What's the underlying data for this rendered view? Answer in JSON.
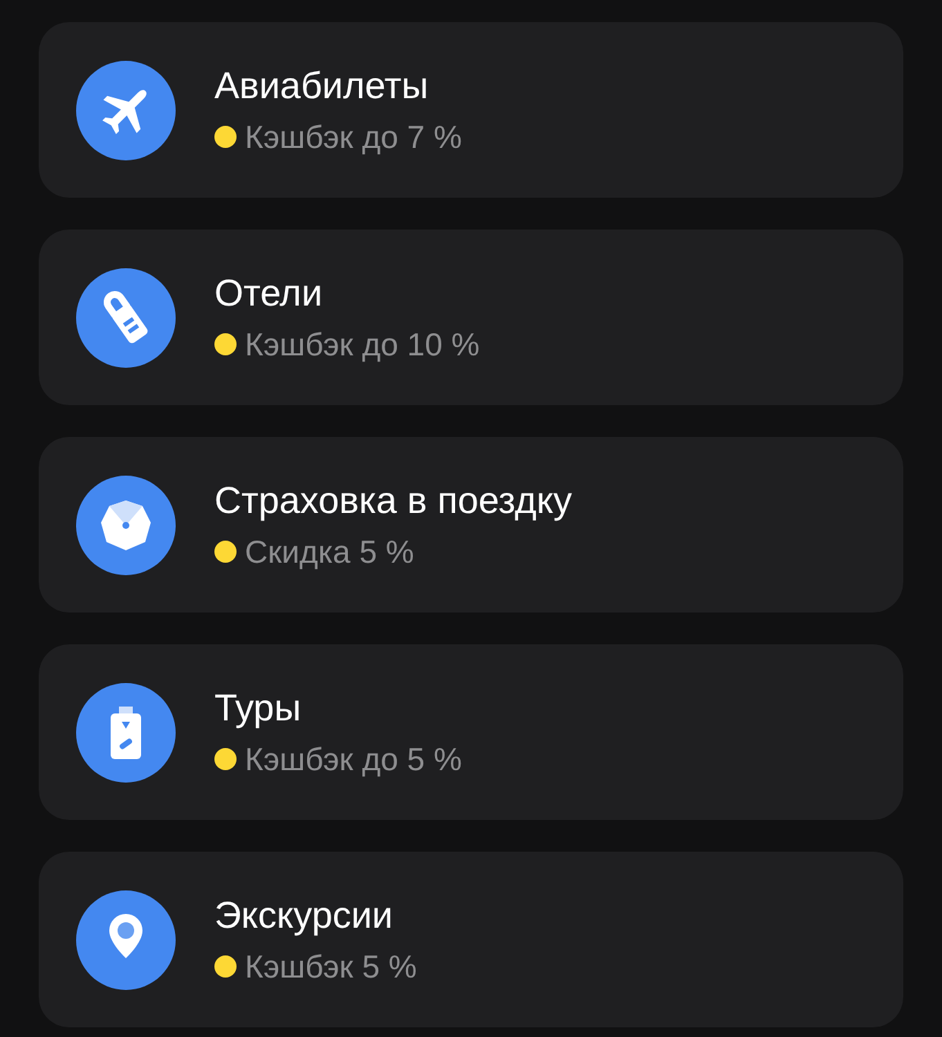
{
  "items": [
    {
      "title": "Авиабилеты",
      "subtitle": "Кэшбэк до 7 %"
    },
    {
      "title": "Отели",
      "subtitle": "Кэшбэк до 10 %"
    },
    {
      "title": "Страховка в поездку",
      "subtitle": "Скидка 5 %"
    },
    {
      "title": "Туры",
      "subtitle": "Кэшбэк до 5 %"
    },
    {
      "title": "Экскурсии",
      "subtitle": "Кэшбэк 5 %"
    }
  ]
}
